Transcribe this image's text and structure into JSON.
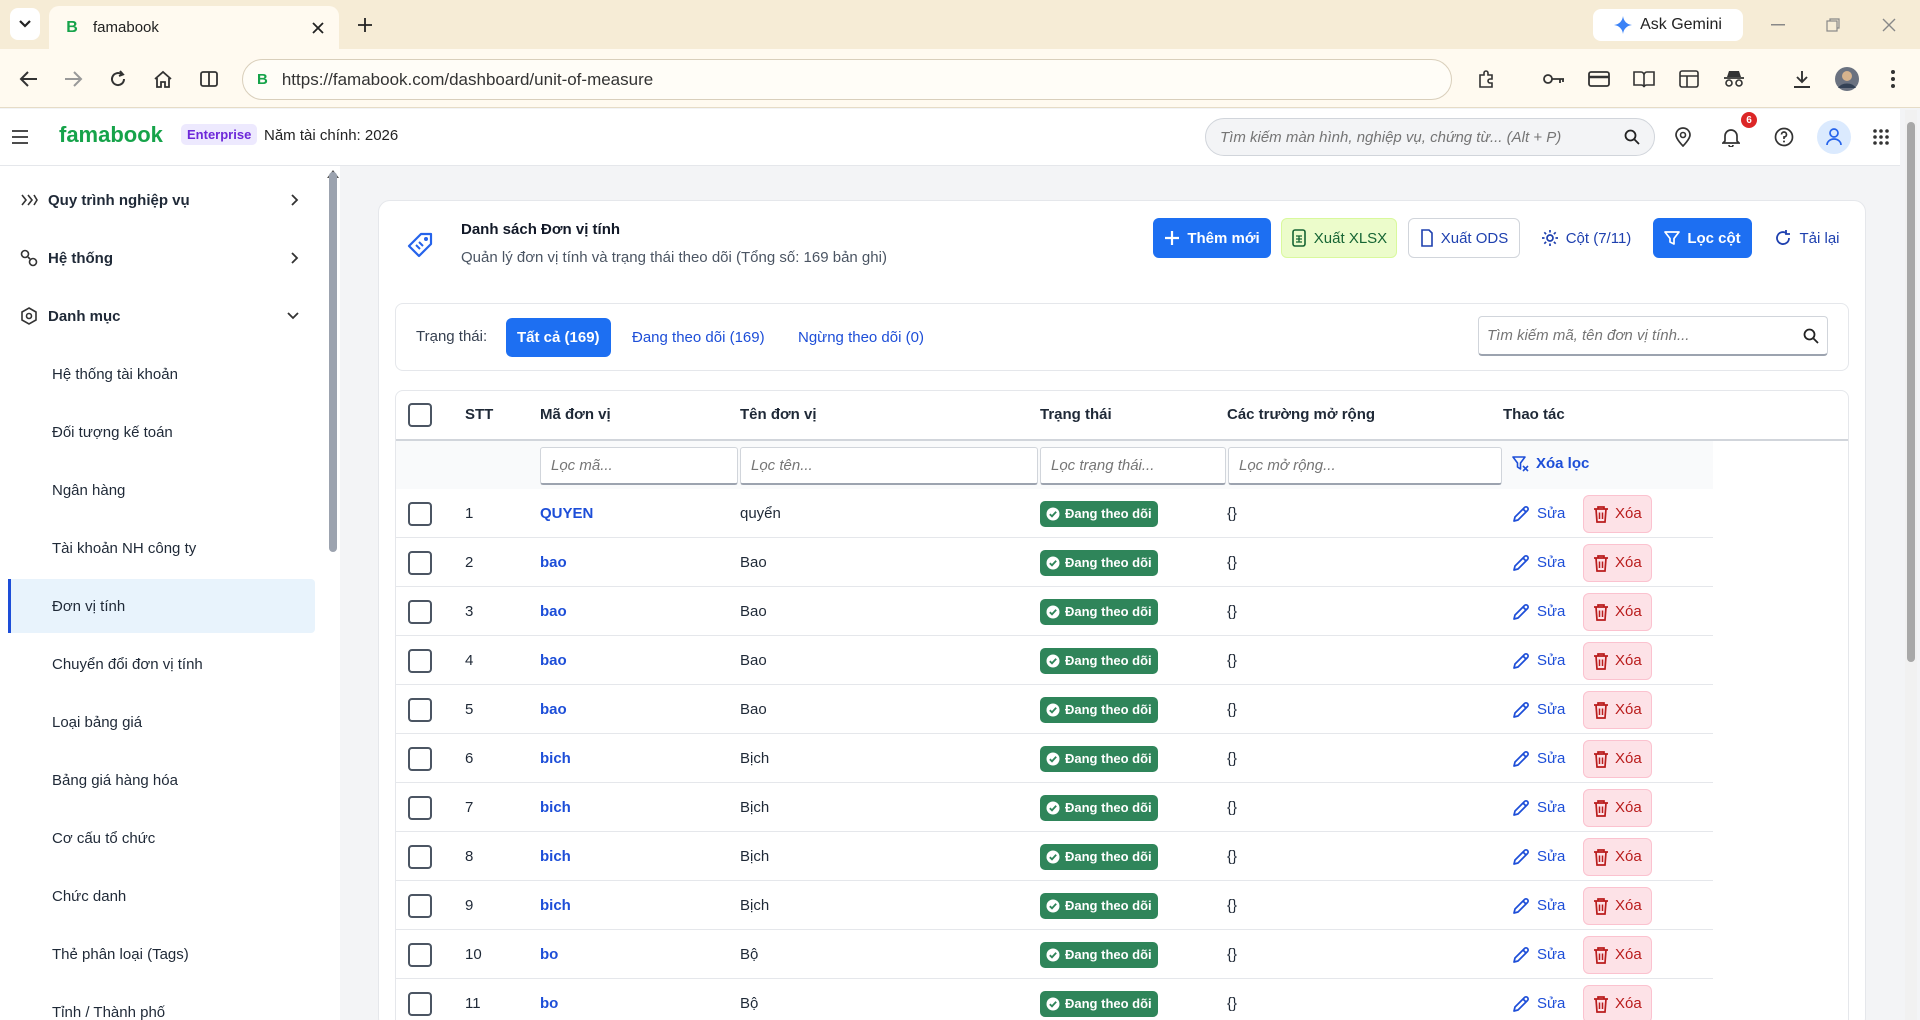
{
  "browser": {
    "tab_title": "famabook",
    "tab_favicon": "B",
    "new_tab_label": "+",
    "gemini_label": "Ask Gemini",
    "url_icon": "B",
    "url": "https://famabook.com/dashboard/unit-of-measure"
  },
  "header": {
    "logo": "famabook",
    "plan_badge": "Enterprise",
    "fiscal_year": "Năm tài chính: 2026",
    "search_placeholder": "Tìm kiếm màn hình, nghiệp vụ, chứng từ... (Alt + P)",
    "notification_count": "6"
  },
  "sidebar": {
    "groups": [
      {
        "label": "Quy trình nghiệp vụ",
        "icon": "chevrons-right-icon",
        "expanded": false
      },
      {
        "label": "Hệ thống",
        "icon": "settings-network-icon",
        "expanded": false
      },
      {
        "label": "Danh mục",
        "icon": "hexagon-icon",
        "expanded": true
      }
    ],
    "items": [
      {
        "label": "Hệ thống tài khoản"
      },
      {
        "label": "Đối tượng kế toán"
      },
      {
        "label": "Ngân hàng"
      },
      {
        "label": "Tài khoản NH công ty"
      },
      {
        "label": "Đơn vị tính",
        "active": true
      },
      {
        "label": "Chuyển đổi đơn vị tính"
      },
      {
        "label": "Loại bảng giá"
      },
      {
        "label": "Bảng giá hàng hóa"
      },
      {
        "label": "Cơ cấu tổ chức"
      },
      {
        "label": "Chức danh"
      },
      {
        "label": "Thẻ phân loại (Tags)"
      },
      {
        "label": "Tỉnh / Thành phố"
      }
    ]
  },
  "page": {
    "title": "Danh sách Đơn vị tính",
    "subtitle": "Quản lý đơn vị tính và trạng thái theo dõi (Tổng số: 169 bản ghi)",
    "actions": {
      "add": "Thêm mới",
      "export_xlsx": "Xuất XLSX",
      "export_ods": "Xuất ODS",
      "columns": "Cột (7/11)",
      "filter_columns": "Lọc cột",
      "reload": "Tải lại"
    }
  },
  "filters": {
    "status_label": "Trạng thái:",
    "chips": [
      "Tất cả (169)",
      "Đang theo dõi (169)",
      "Ngừng theo dõi (0)"
    ],
    "active_chip": 0,
    "search_placeholder": "Tìm kiếm mã, tên đơn vị tính..."
  },
  "table": {
    "headers": {
      "stt": "STT",
      "code": "Mã đơn vị",
      "name": "Tên đơn vị",
      "status": "Trạng thái",
      "ext": "Các trường mở rộng",
      "actions": "Thao tác"
    },
    "filter_placeholders": {
      "code": "Lọc mã...",
      "name": "Lọc tên...",
      "status": "Lọc trạng thái...",
      "ext": "Lọc mở rộng..."
    },
    "clear_filter": "Xóa lọc",
    "edit_label": "Sửa",
    "delete_label": "Xóa",
    "rows": [
      {
        "stt": "1",
        "code": "QUYEN",
        "name": "quyển",
        "status": "Đang theo dõi",
        "ext": "{}"
      },
      {
        "stt": "2",
        "code": "bao",
        "name": "Bao",
        "status": "Đang theo dõi",
        "ext": "{}"
      },
      {
        "stt": "3",
        "code": "bao",
        "name": "Bao",
        "status": "Đang theo dõi",
        "ext": "{}"
      },
      {
        "stt": "4",
        "code": "bao",
        "name": "Bao",
        "status": "Đang theo dõi",
        "ext": "{}"
      },
      {
        "stt": "5",
        "code": "bao",
        "name": "Bao",
        "status": "Đang theo dõi",
        "ext": "{}"
      },
      {
        "stt": "6",
        "code": "bich",
        "name": "Bịch",
        "status": "Đang theo dõi",
        "ext": "{}"
      },
      {
        "stt": "7",
        "code": "bich",
        "name": "Bịch",
        "status": "Đang theo dõi",
        "ext": "{}"
      },
      {
        "stt": "8",
        "code": "bich",
        "name": "Bịch",
        "status": "Đang theo dõi",
        "ext": "{}"
      },
      {
        "stt": "9",
        "code": "bich",
        "name": "Bịch",
        "status": "Đang theo dõi",
        "ext": "{}"
      },
      {
        "stt": "10",
        "code": "bo",
        "name": "Bộ",
        "status": "Đang theo dõi",
        "ext": "{}"
      },
      {
        "stt": "11",
        "code": "bo",
        "name": "Bộ",
        "status": "Đang theo dõi",
        "ext": "{}"
      }
    ]
  },
  "colors": {
    "brand": "#16a34a",
    "primary": "#1d6ff2",
    "status_active": "#2f855a",
    "danger": "#b91c1c"
  }
}
